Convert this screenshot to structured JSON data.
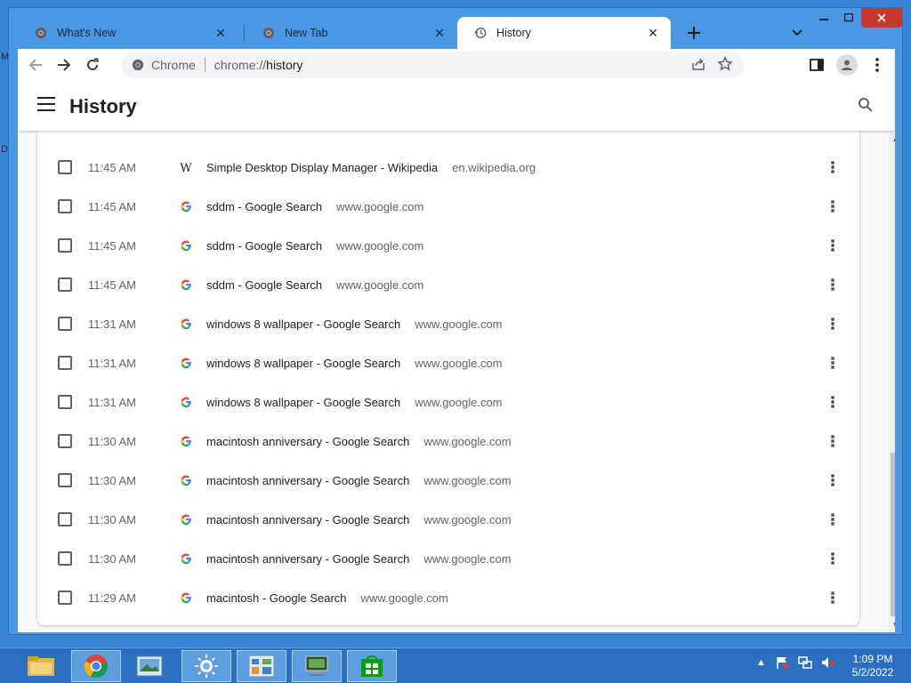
{
  "desktop": {
    "edge_letters": [
      "M",
      "D"
    ]
  },
  "window": {
    "caption_buttons": [
      "minimize",
      "maximize",
      "close"
    ]
  },
  "tabs": [
    {
      "title": "What's New",
      "icon": "chrome-icon",
      "active": false
    },
    {
      "title": "New Tab",
      "icon": "chrome-icon",
      "active": false
    },
    {
      "title": "History",
      "icon": "history-icon",
      "active": true
    }
  ],
  "toolbar": {
    "site_label": "Chrome",
    "url_scheme": "chrome://",
    "url_path": "history"
  },
  "page": {
    "title": "History"
  },
  "history": [
    {
      "time": "11:45 AM",
      "favicon": "wikipedia",
      "title": "Simple Desktop Display Manager - Wikipedia",
      "domain": "en.wikipedia.org"
    },
    {
      "time": "11:45 AM",
      "favicon": "google",
      "title": "sddm - Google Search",
      "domain": "www.google.com"
    },
    {
      "time": "11:45 AM",
      "favicon": "google",
      "title": "sddm - Google Search",
      "domain": "www.google.com"
    },
    {
      "time": "11:45 AM",
      "favicon": "google",
      "title": "sddm - Google Search",
      "domain": "www.google.com"
    },
    {
      "time": "11:31 AM",
      "favicon": "google",
      "title": "windows 8 wallpaper - Google Search",
      "domain": "www.google.com"
    },
    {
      "time": "11:31 AM",
      "favicon": "google",
      "title": "windows 8 wallpaper - Google Search",
      "domain": "www.google.com"
    },
    {
      "time": "11:31 AM",
      "favicon": "google",
      "title": "windows 8 wallpaper - Google Search",
      "domain": "www.google.com"
    },
    {
      "time": "11:30 AM",
      "favicon": "google",
      "title": "macintosh anniversary - Google Search",
      "domain": "www.google.com"
    },
    {
      "time": "11:30 AM",
      "favicon": "google",
      "title": "macintosh anniversary - Google Search",
      "domain": "www.google.com"
    },
    {
      "time": "11:30 AM",
      "favicon": "google",
      "title": "macintosh anniversary - Google Search",
      "domain": "www.google.com"
    },
    {
      "time": "11:30 AM",
      "favicon": "google",
      "title": "macintosh anniversary - Google Search",
      "domain": "www.google.com"
    },
    {
      "time": "11:29 AM",
      "favicon": "google",
      "title": "macintosh - Google Search",
      "domain": "www.google.com"
    }
  ],
  "taskbar": {
    "apps": [
      "file-explorer-icon",
      "chrome-icon",
      "image-viewer-icon",
      "settings-icon",
      "control-panel-icon",
      "remote-desktop-icon",
      "store-icon"
    ],
    "clock_time": "1:09 PM",
    "clock_date": "5/2/2022"
  },
  "colors": {
    "titlebar": "#4a97e3",
    "taskbar": "#2b6fc0",
    "close": "#c7372b"
  }
}
